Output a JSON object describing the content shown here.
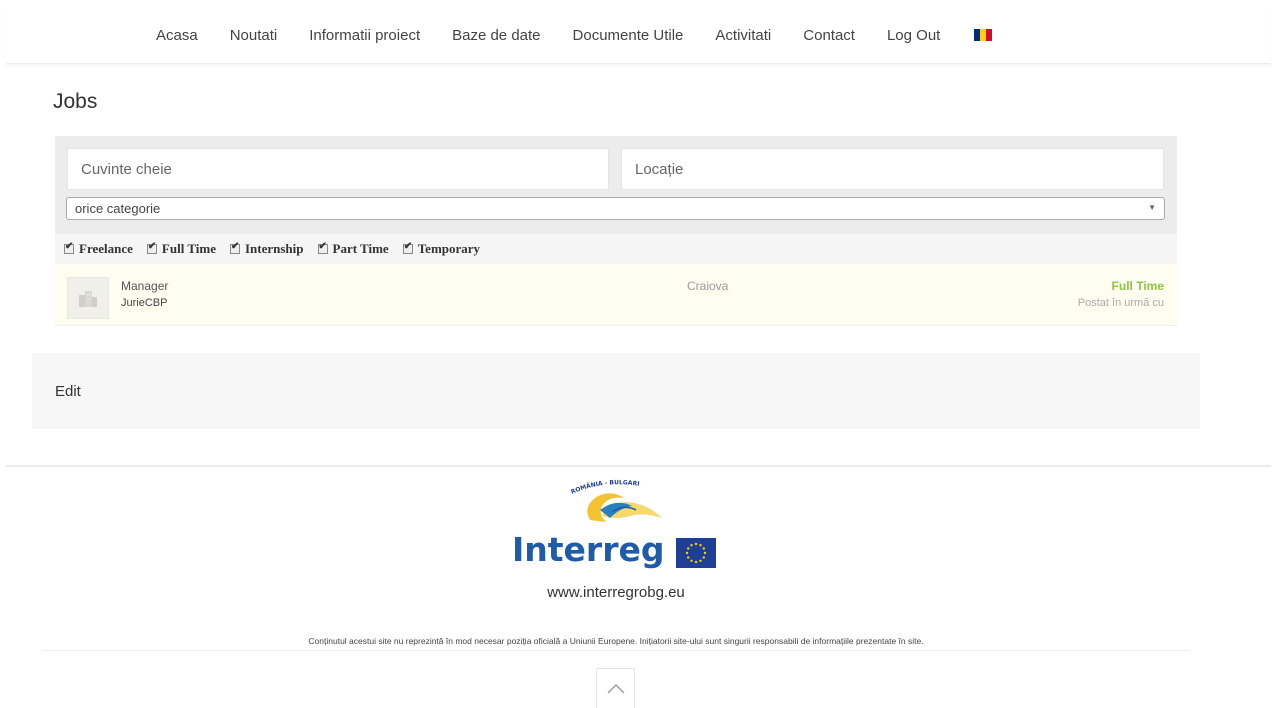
{
  "nav": {
    "items": [
      {
        "label": "Acasa"
      },
      {
        "label": "Noutati"
      },
      {
        "label": "Informatii proiect"
      },
      {
        "label": "Baze de date"
      },
      {
        "label": "Documente Utile"
      },
      {
        "label": "Activitati"
      },
      {
        "label": "Contact"
      },
      {
        "label": "Log Out"
      }
    ],
    "flag_colors": [
      "#002b7f",
      "#fcd116",
      "#ce1126"
    ]
  },
  "page": {
    "title": "Jobs"
  },
  "search": {
    "keywords_placeholder": "Cuvinte cheie",
    "location_placeholder": "Locație",
    "category_selected": "orice categorie",
    "job_types": [
      {
        "label": "Freelance",
        "checked": true
      },
      {
        "label": "Full Time",
        "checked": true
      },
      {
        "label": "Internship",
        "checked": true
      },
      {
        "label": "Part Time",
        "checked": true
      },
      {
        "label": "Temporary",
        "checked": true
      }
    ]
  },
  "listings": [
    {
      "title": "Manager",
      "company": "JurieCBP",
      "location": "Craiova",
      "type": "Full Time",
      "posted": "Postat în urmă cu",
      "type_color": "#8cc63f"
    }
  ],
  "edit": {
    "label": "Edit"
  },
  "footer": {
    "logo_text": "Interreg",
    "logo_arc_text": "ROMÂNIA - BULGARIA",
    "website": "www.interregrobg.eu",
    "disclaimer": "Conținutul acestui site nu reprezintă în mod necesar poziția oficială a Uniunii Europene. Inițiatorii site-ului sunt singurii responsabili de informațiile prezentate în site.",
    "brand_color": "#1e5ba8"
  }
}
